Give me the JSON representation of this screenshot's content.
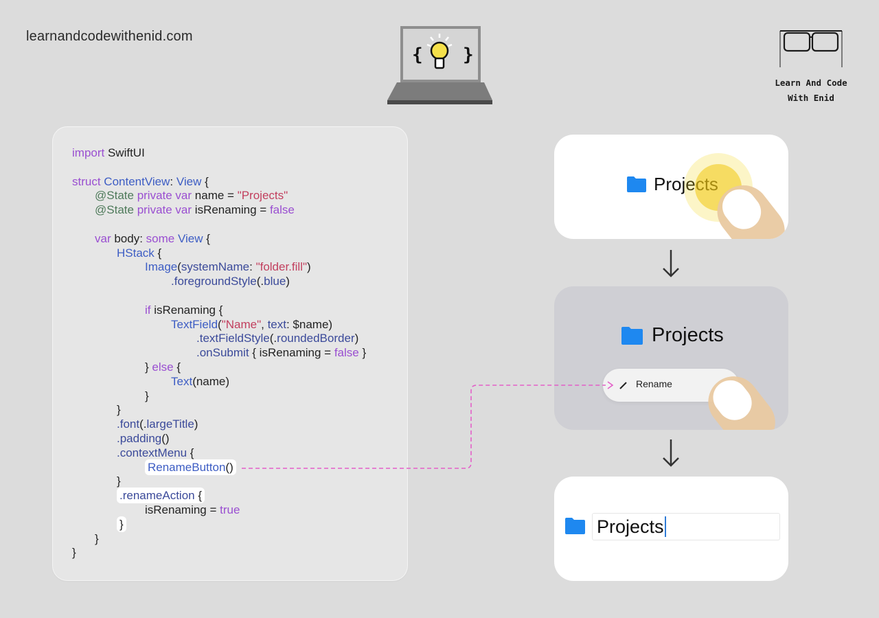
{
  "site_url": "learnandcodewithenid.com",
  "brand": {
    "line1": "Learn And Code",
    "line2": "With Enid"
  },
  "laptop": {
    "left_brace": "{",
    "right_brace": "}"
  },
  "code": {
    "lines": [
      {
        "indent": 0,
        "tokens": [
          [
            "kw",
            "import"
          ],
          [
            "plain",
            " SwiftUI"
          ]
        ]
      },
      {
        "indent": 0,
        "tokens": []
      },
      {
        "indent": 0,
        "tokens": [
          [
            "kw",
            "struct"
          ],
          [
            "plain",
            " "
          ],
          [
            "type",
            "ContentView"
          ],
          [
            "plain",
            ": "
          ],
          [
            "type",
            "View"
          ],
          [
            "plain",
            " {"
          ]
        ]
      },
      {
        "indent": 1,
        "tokens": [
          [
            "attr",
            "@State"
          ],
          [
            "plain",
            " "
          ],
          [
            "kw",
            "private var"
          ],
          [
            "plain",
            " name = "
          ],
          [
            "str",
            "\"Projects\""
          ]
        ]
      },
      {
        "indent": 1,
        "tokens": [
          [
            "attr",
            "@State"
          ],
          [
            "plain",
            " "
          ],
          [
            "kw",
            "private var"
          ],
          [
            "plain",
            " isRenaming = "
          ],
          [
            "kw",
            "false"
          ]
        ]
      },
      {
        "indent": 0,
        "tokens": []
      },
      {
        "indent": 1,
        "tokens": [
          [
            "kw",
            "var"
          ],
          [
            "plain",
            " body: "
          ],
          [
            "kw",
            "some"
          ],
          [
            "plain",
            " "
          ],
          [
            "type",
            "View"
          ],
          [
            "plain",
            " {"
          ]
        ]
      },
      {
        "indent": 2,
        "tokens": [
          [
            "type",
            "HStack"
          ],
          [
            "plain",
            " {"
          ]
        ]
      },
      {
        "indent": 3,
        "tokens": [
          [
            "type",
            "Image"
          ],
          [
            "plain",
            "("
          ],
          [
            "prop",
            "systemName"
          ],
          [
            "plain",
            ": "
          ],
          [
            "str",
            "\"folder.fill\""
          ],
          [
            "plain",
            ")"
          ]
        ]
      },
      {
        "indent": 4,
        "tokens": [
          [
            "prop",
            ".foregroundStyle"
          ],
          [
            "plain",
            "(."
          ],
          [
            "prop",
            "blue"
          ],
          [
            "plain",
            ")"
          ]
        ]
      },
      {
        "indent": 0,
        "tokens": []
      },
      {
        "indent": 3,
        "tokens": [
          [
            "kw",
            "if"
          ],
          [
            "plain",
            " isRenaming {"
          ]
        ]
      },
      {
        "indent": 4,
        "tokens": [
          [
            "type",
            "TextField"
          ],
          [
            "plain",
            "("
          ],
          [
            "str",
            "\"Name\""
          ],
          [
            "plain",
            ", "
          ],
          [
            "prop",
            "text"
          ],
          [
            "plain",
            ": $name)"
          ]
        ]
      },
      {
        "indent": 5,
        "tokens": [
          [
            "prop",
            ".textFieldStyle"
          ],
          [
            "plain",
            "(."
          ],
          [
            "prop",
            "roundedBorder"
          ],
          [
            "plain",
            ")"
          ]
        ]
      },
      {
        "indent": 5,
        "tokens": [
          [
            "prop",
            ".onSubmit"
          ],
          [
            "plain",
            " { isRenaming = "
          ],
          [
            "kw",
            "false"
          ],
          [
            "plain",
            " }"
          ]
        ]
      },
      {
        "indent": 3,
        "tokens": [
          [
            "plain",
            "} "
          ],
          [
            "kw",
            "else"
          ],
          [
            "plain",
            " {"
          ]
        ]
      },
      {
        "indent": 4,
        "tokens": [
          [
            "type",
            "Text"
          ],
          [
            "plain",
            "(name)"
          ]
        ]
      },
      {
        "indent": 3,
        "tokens": [
          [
            "plain",
            "}"
          ]
        ]
      },
      {
        "indent": 2,
        "tokens": [
          [
            "plain",
            "}"
          ]
        ]
      },
      {
        "indent": 2,
        "tokens": [
          [
            "prop",
            ".font"
          ],
          [
            "plain",
            "(."
          ],
          [
            "prop",
            "largeTitle"
          ],
          [
            "plain",
            ")"
          ]
        ]
      },
      {
        "indent": 2,
        "tokens": [
          [
            "prop",
            ".padding"
          ],
          [
            "plain",
            "()"
          ]
        ]
      },
      {
        "indent": 2,
        "tokens": [
          [
            "prop",
            ".contextMenu"
          ],
          [
            "plain",
            " {"
          ]
        ]
      },
      {
        "indent": 3,
        "highlight": true,
        "tokens": [
          [
            "type",
            "RenameButton"
          ],
          [
            "plain",
            "()"
          ]
        ]
      },
      {
        "indent": 2,
        "tokens": [
          [
            "plain",
            "}"
          ]
        ]
      },
      {
        "indent": 2,
        "highlight": true,
        "tokens": [
          [
            "prop",
            ".renameAction"
          ],
          [
            "plain",
            " {"
          ]
        ]
      },
      {
        "indent": 3,
        "tokens": [
          [
            "plain",
            "isRenaming = "
          ],
          [
            "kw",
            "true"
          ]
        ]
      },
      {
        "indent": 2,
        "highlight": true,
        "tokens": [
          [
            "plain",
            "}"
          ]
        ]
      },
      {
        "indent": 1,
        "tokens": [
          [
            "plain",
            "}"
          ]
        ]
      },
      {
        "indent": 0,
        "tokens": [
          [
            "plain",
            "}"
          ]
        ]
      }
    ]
  },
  "panels": {
    "step1": {
      "label": "Projects"
    },
    "step2": {
      "label": "Projects",
      "menu_item": "Rename"
    },
    "step3": {
      "field_value": "Projects"
    }
  },
  "colors": {
    "background": "#dcdcdc",
    "folder_blue": "#1e88f0",
    "connector_pink": "#e35fc8",
    "tap_yellow": "#f3d91e"
  }
}
